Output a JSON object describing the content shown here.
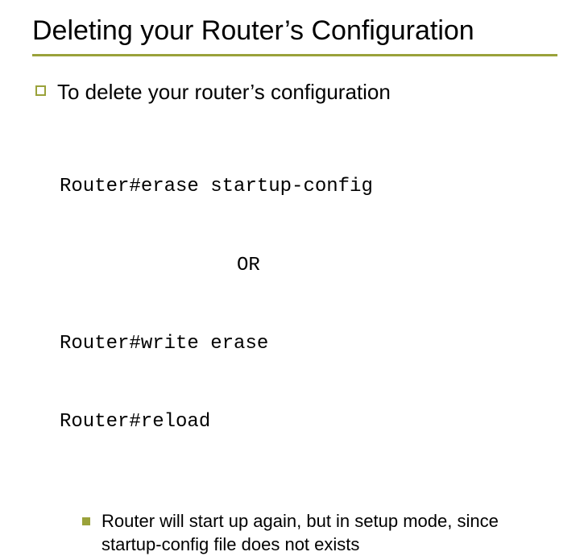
{
  "title": "Deleting your Router’s Configuration",
  "bullet1": "To delete your router’s configuration",
  "code": {
    "line1": "Router#erase startup-config",
    "or": "OR",
    "line2": "Router#write erase",
    "line3": "Router#reload"
  },
  "bullet2": "Router will start up again, but in setup mode, since startup-config file does not exists"
}
